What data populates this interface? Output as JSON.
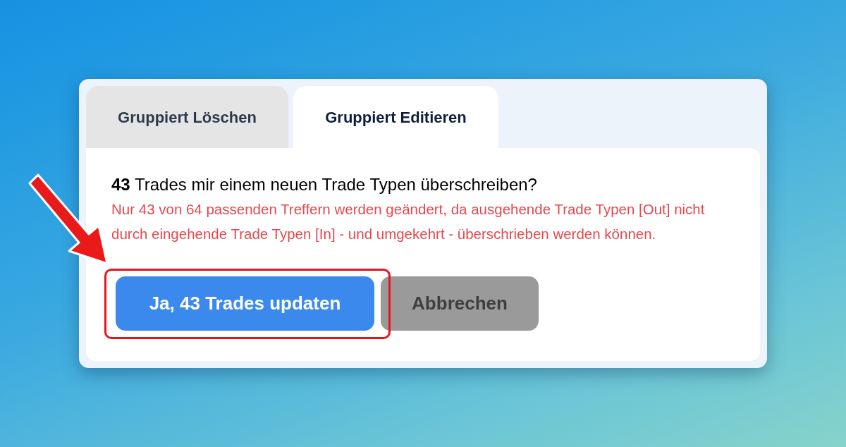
{
  "tabs": [
    {
      "label": "Gruppiert Löschen",
      "selected": false
    },
    {
      "label": "Gruppiert Editieren",
      "selected": true
    }
  ],
  "question": "**43** Trades mir einem neuen Trade Typen überschreiben?",
  "notice": "Nur 43 von 64 passenden Treffern werden geändert, da ausgehende Trade Typen [Out] nicht durch eingehende Trade Typen [In] - und umgekehrt - überschrieben werden können.",
  "buttons": [
    {
      "label": "Ja, 43 Trades updaten",
      "kind": "primary",
      "highlighted": true
    },
    {
      "label": "Abbrechen",
      "kind": "secondary",
      "highlighted": false
    }
  ]
}
